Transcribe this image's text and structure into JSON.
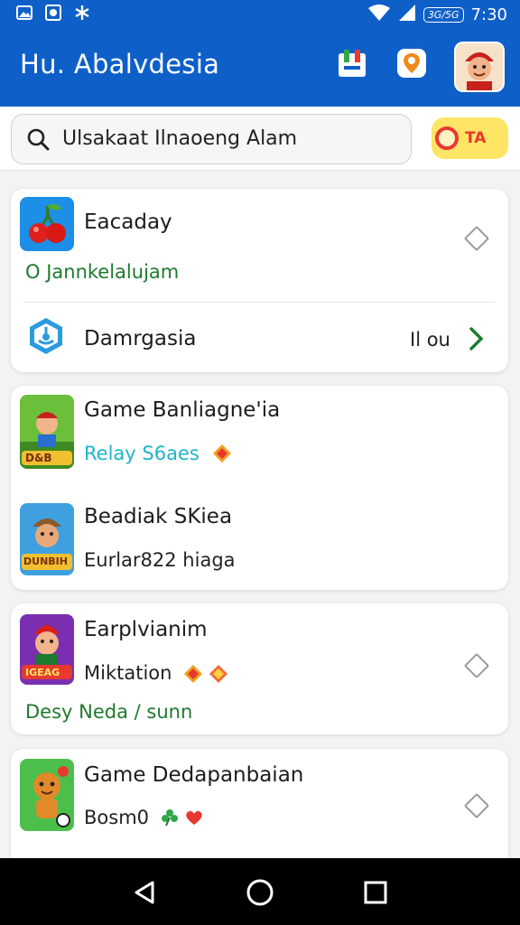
{
  "status_bar": {
    "network": "3G/5G",
    "time": "7:30"
  },
  "app_bar": {
    "title": "Hu. Abalvdesia"
  },
  "search": {
    "text": "Ulsakaat Ilnaoeng Alam",
    "badge_label": "TA"
  },
  "card1": {
    "item1": {
      "title": "Eacaday",
      "subtitle": "O Jannkelalujam"
    },
    "item2": {
      "title": "Damrgasia",
      "trailing": "Il ou"
    }
  },
  "card2": {
    "item1": {
      "title": "Game Banliagne'ia",
      "subtitle": "Relay S6aes",
      "thumb_label": "D&B"
    },
    "item2": {
      "title": "Beadiak SKiea",
      "subtitle": "Eurlar822 hiaga",
      "thumb_label": "DUNBIH"
    }
  },
  "card3": {
    "item1": {
      "title": "Earplvianim",
      "subtitle": "Miktation",
      "footer": "Desy Neda / sunn",
      "thumb_label": "IGEAG"
    }
  },
  "card4": {
    "item1": {
      "title": "Game Dedapanbaian",
      "subtitle": "Bosm0"
    }
  },
  "colors": {
    "primary": "#0f5fc8",
    "green": "#1e7a2e",
    "cyan": "#1eb4c8",
    "accent_yellow": "#ffe566",
    "accent_red": "#e8392e"
  },
  "icons": [
    "image-icon",
    "photo-icon",
    "sync-icon",
    "wifi-icon",
    "signal-icon",
    "bookmark-icon",
    "location-pin-icon",
    "avatar",
    "search-icon",
    "diamond-icon",
    "chevron-right-icon",
    "back-icon",
    "home-icon",
    "recents-icon"
  ]
}
